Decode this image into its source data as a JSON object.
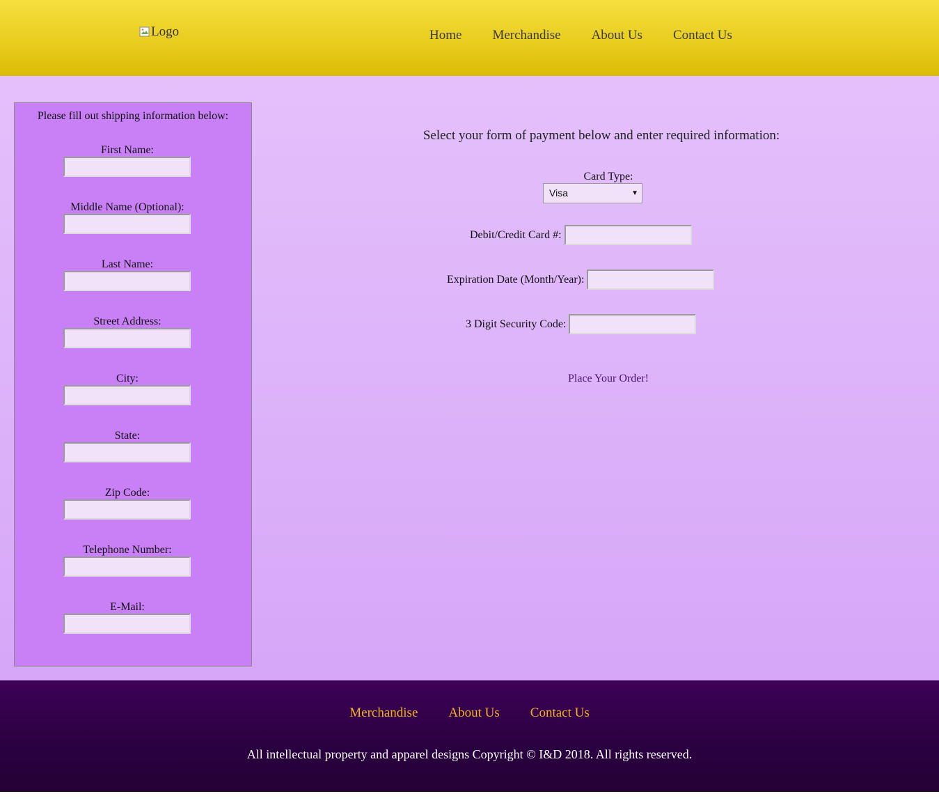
{
  "header": {
    "logo_alt": "Logo",
    "nav": [
      "Home",
      "Merchandise",
      "About Us",
      "Contact Us"
    ]
  },
  "shipping": {
    "title": "Please fill out shipping information below:",
    "fields": [
      {
        "label": "First Name:",
        "value": ""
      },
      {
        "label": "Middle Name (Optional):",
        "value": ""
      },
      {
        "label": "Last Name:",
        "value": ""
      },
      {
        "label": "Street Address:",
        "value": ""
      },
      {
        "label": "City:",
        "value": ""
      },
      {
        "label": "State:",
        "value": ""
      },
      {
        "label": "Zip Code:",
        "value": ""
      },
      {
        "label": "Telephone Number:",
        "value": ""
      },
      {
        "label": "E-Mail:",
        "value": ""
      }
    ]
  },
  "payment": {
    "title": "Select your form of payment below and enter required information:",
    "card_type_label": "Card Type:",
    "card_type_value": "Visa",
    "card_number_label": "Debit/Credit Card #:",
    "card_number_value": "",
    "expiration_label": "Expiration Date (Month/Year):",
    "expiration_value": "",
    "security_label": "3 Digit Security Code:",
    "security_value": "",
    "submit_label": "Place Your Order!"
  },
  "footer": {
    "nav": [
      "Merchandise",
      "About Us",
      "Contact Us"
    ],
    "copyright": "All intellectual property and apparel designs Copyright © I&D 2018. All rights reserved."
  },
  "colors": {
    "header": "#e9cd1f",
    "main": "#e0b8fa",
    "shipping_panel": "#c980f7",
    "input_bg": "#f1e2f9",
    "footer": "#2a0140",
    "footer_link": "#f0b420",
    "order_link": "#4a1670"
  }
}
